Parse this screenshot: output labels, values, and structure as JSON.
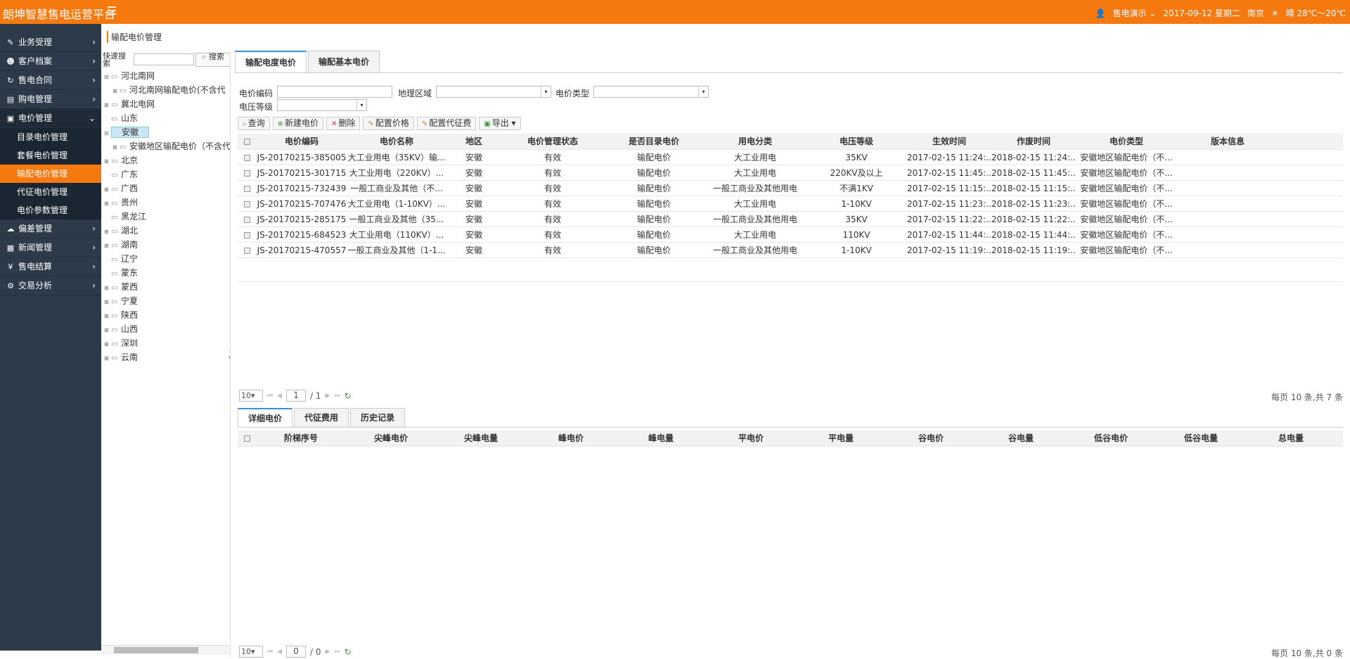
{
  "header": {
    "title": "朗坤智慧售电运营平台",
    "user": "售电演示",
    "date": "2017-09-12 星期二",
    "city": "南京",
    "weather": "晴 28℃～20℃"
  },
  "sidebar": {
    "items": [
      {
        "label": "业务受理",
        "icon": "edit-icon"
      },
      {
        "label": "客户档案",
        "icon": "users-icon"
      },
      {
        "label": "售电合同",
        "icon": "refresh-icon"
      },
      {
        "label": "购电管理",
        "icon": "cart-icon"
      },
      {
        "label": "电价管理",
        "icon": "briefcase-icon"
      },
      {
        "label": "偏差管理",
        "icon": "cloud-icon"
      },
      {
        "label": "新闻管理",
        "icon": "news-icon"
      },
      {
        "label": "售电结算",
        "icon": "money-icon"
      },
      {
        "label": "交易分析",
        "icon": "analytics-icon"
      }
    ],
    "subitems": [
      "目录电价管理",
      "套餐电价管理",
      "输配电价管理",
      "代征电价管理",
      "电价参数管理"
    ]
  },
  "page": {
    "title": "输配电价管理"
  },
  "tree": {
    "search_label": "快速搜索",
    "search_button": "搜索",
    "nodes": [
      "河北南网",
      "河北南网输配电价(不含代",
      "冀北电网",
      "山东",
      "安徽",
      "安徽地区输配电价（不含代",
      "北京",
      "广东",
      "广西",
      "贵州",
      "黑龙江",
      "湖北",
      "湖南",
      "辽宁",
      "蒙东",
      "蒙西",
      "宁夏",
      "陕西",
      "山西",
      "深圳",
      "云南"
    ]
  },
  "tabs_top": [
    "输配电度电价",
    "输配基本电价"
  ],
  "filter": {
    "code_label": "电价编码",
    "region_label": "地理区域",
    "type_label": "电价类型",
    "voltage_label": "电压等级"
  },
  "toolbar": {
    "query": "查询",
    "new": "新建电价",
    "delete": "删除",
    "config_price": "配置价格",
    "config_levy": "配置代征费",
    "export": "导出"
  },
  "grid": {
    "headers": [
      "电价编码",
      "电价名称",
      "地区",
      "电价管理状态",
      "是否目录电价",
      "用电分类",
      "电压等级",
      "生效时间",
      "作废时间",
      "电价类型",
      "版本信息"
    ],
    "rows": [
      [
        "JS-20170215-385005",
        "大工业用电（35KV）输...",
        "安徽",
        "有效",
        "输配电价",
        "大工业用电",
        "35KV",
        "2017-02-15 11:24:...",
        "2018-02-15 11:24:...",
        "安徽地区输配电价（不..."
      ],
      [
        "JS-20170215-301715",
        "大工业用电（220KV）...",
        "安徽",
        "有效",
        "输配电价",
        "大工业用电",
        "220KV及以上",
        "2017-02-15 11:45:...",
        "2018-02-15 11:45:...",
        "安徽地区输配电价（不..."
      ],
      [
        "JS-20170215-732439",
        "一般工商业及其他（不...",
        "安徽",
        "有效",
        "输配电价",
        "一般工商业及其他用电",
        "不满1KV",
        "2017-02-15 11:15:...",
        "2018-02-15 11:15:...",
        "安徽地区输配电价（不..."
      ],
      [
        "JS-20170215-707476",
        "大工业用电（1-10KV）...",
        "安徽",
        "有效",
        "输配电价",
        "大工业用电",
        "1-10KV",
        "2017-02-15 11:23:...",
        "2018-02-15 11:23:...",
        "安徽地区输配电价（不..."
      ],
      [
        "JS-20170215-285175",
        "一般工商业及其他（35...",
        "安徽",
        "有效",
        "输配电价",
        "一般工商业及其他用电",
        "35KV",
        "2017-02-15 11:22:...",
        "2018-02-15 11:22:...",
        "安徽地区输配电价（不..."
      ],
      [
        "JS-20170215-684523",
        "大工业用电（110KV）...",
        "安徽",
        "有效",
        "输配电价",
        "大工业用电",
        "110KV",
        "2017-02-15 11:44:...",
        "2018-02-15 11:44:...",
        "安徽地区输配电价（不..."
      ],
      [
        "JS-20170215-470557",
        "一般工商业及其他（1-1...",
        "安徽",
        "有效",
        "输配电价",
        "一般工商业及其他用电",
        "1-10KV",
        "2017-02-15 11:19:...",
        "2018-02-15 11:19:...",
        "安徽地区输配电价（不..."
      ]
    ]
  },
  "pager1": {
    "size": "10",
    "page": "1",
    "total_pages": "/ 1",
    "info": "每页 10 条,共 7 条"
  },
  "tabs_bottom": [
    "详细电价",
    "代征费用",
    "历史记录"
  ],
  "grid2": {
    "headers": [
      "阶梯序号",
      "尖峰电价",
      "尖峰电量",
      "峰电价",
      "峰电量",
      "平电价",
      "平电量",
      "谷电价",
      "谷电量",
      "低谷电价",
      "低谷电量",
      "总电量"
    ]
  },
  "pager2": {
    "size": "10",
    "page": "0",
    "total_pages": "/ 0",
    "info": "每页 10 条,共 0 条"
  }
}
